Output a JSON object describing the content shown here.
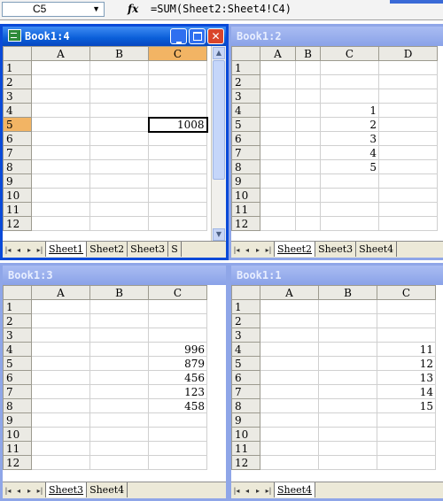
{
  "formula_bar": {
    "name_box": "C5",
    "fx_icon": "fx",
    "formula": "=SUM(Sheet2:Sheet4!C4)"
  },
  "windows": {
    "w1": {
      "title": "Book1:4",
      "columns": [
        "A",
        "B",
        "C"
      ],
      "rows": [
        "1",
        "2",
        "3",
        "4",
        "5",
        "6",
        "7",
        "8",
        "9",
        "10",
        "11",
        "12"
      ],
      "cells": {
        "5": {
          "C": "1008"
        }
      },
      "selected_column": "C",
      "selected_row": "5",
      "tabs": [
        "Sheet1",
        "Sheet2",
        "Sheet3",
        "S"
      ],
      "active_tab": "Sheet1"
    },
    "w2": {
      "title": "Book1:2",
      "columns": [
        "A",
        "B",
        "C",
        "D"
      ],
      "rows": [
        "1",
        "2",
        "3",
        "4",
        "5",
        "6",
        "7",
        "8",
        "9",
        "10",
        "11",
        "12"
      ],
      "cells": {
        "4": {
          "C": "1"
        },
        "5": {
          "C": "2"
        },
        "6": {
          "C": "3"
        },
        "7": {
          "C": "4"
        },
        "8": {
          "C": "5"
        }
      },
      "tabs": [
        "Sheet2",
        "Sheet3",
        "Sheet4"
      ],
      "active_tab": "Sheet2"
    },
    "w3": {
      "title": "Book1:3",
      "columns": [
        "A",
        "B",
        "C"
      ],
      "rows": [
        "1",
        "2",
        "3",
        "4",
        "5",
        "6",
        "7",
        "8",
        "9",
        "10",
        "11",
        "12"
      ],
      "cells": {
        "4": {
          "C": "996"
        },
        "5": {
          "C": "879"
        },
        "6": {
          "C": "456"
        },
        "7": {
          "C": "123"
        },
        "8": {
          "C": "458"
        }
      },
      "tabs": [
        "Sheet3",
        "Sheet4"
      ],
      "active_tab": "Sheet3"
    },
    "w4": {
      "title": "Book1:1",
      "columns": [
        "A",
        "B",
        "C"
      ],
      "rows": [
        "1",
        "2",
        "3",
        "4",
        "5",
        "6",
        "7",
        "8",
        "9",
        "10",
        "11",
        "12"
      ],
      "cells": {
        "4": {
          "C": "11"
        },
        "5": {
          "C": "12"
        },
        "6": {
          "C": "13"
        },
        "7": {
          "C": "14"
        },
        "8": {
          "C": "15"
        }
      },
      "tabs": [
        "Sheet4"
      ],
      "active_tab": "Sheet4"
    }
  },
  "tab_nav_icons": [
    "first-sheet-icon",
    "prev-sheet-icon",
    "next-sheet-icon",
    "last-sheet-icon"
  ],
  "colors": {
    "active_title": "#0a5ed8",
    "inactive_title": "#8aa2e8",
    "selected_header": "#f2b464",
    "close_button": "#d9452b"
  }
}
